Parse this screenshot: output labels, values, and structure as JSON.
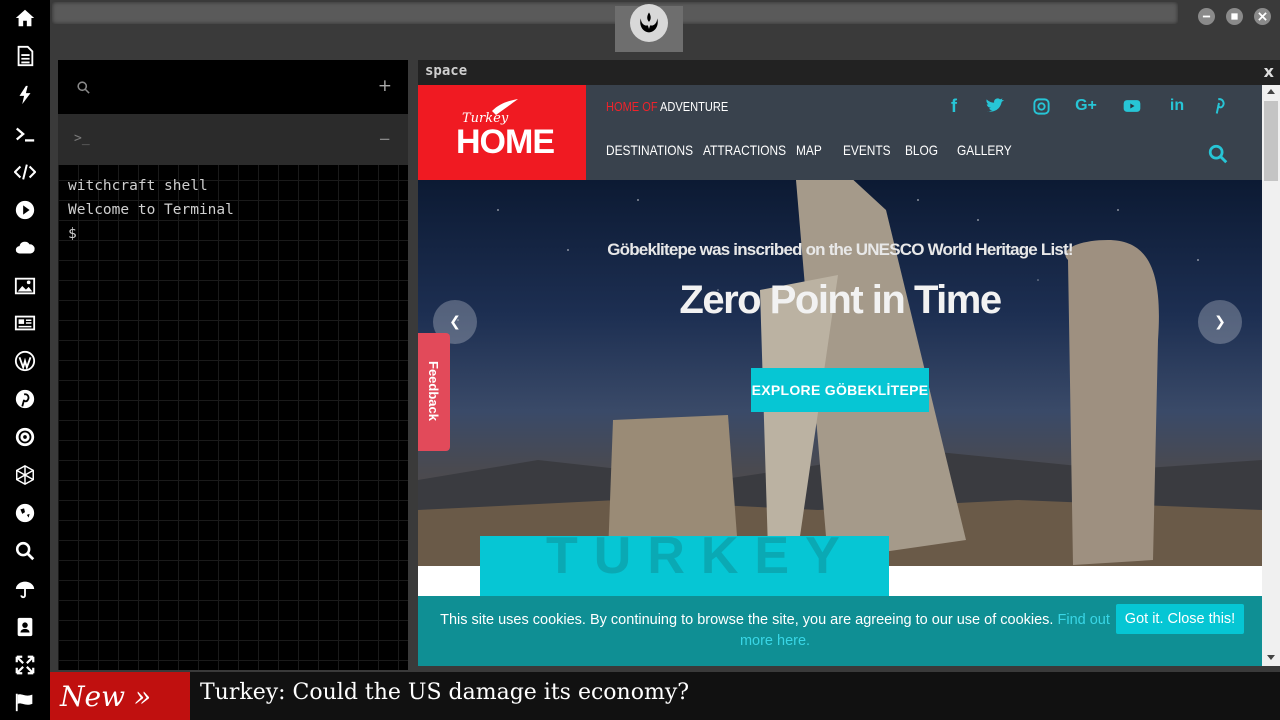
{
  "dock": {
    "items": [
      "home-icon",
      "document-icon",
      "bolt-icon",
      "terminal-icon",
      "code-icon",
      "play-icon",
      "cloud-icon",
      "image-icon",
      "news-icon",
      "wordpress-icon",
      "pinterest-icon",
      "empire-icon",
      "network-icon",
      "globe-icon",
      "search-icon",
      "umbrella-icon",
      "contacts-icon",
      "expand-icon",
      "flag-icon"
    ]
  },
  "topbar": {
    "logo_icon": "rebel-alliance-icon"
  },
  "terminal": {
    "search_icon": "search-icon",
    "add_label": "+",
    "tab_prompt": ">_",
    "tab_minus": "−",
    "lines": [
      "witchcraft shell",
      "Welcome to Terminal",
      "$"
    ]
  },
  "space": {
    "title": "space",
    "close_label": "x",
    "site": {
      "logo_script": "Turkey",
      "logo_main": "HOME",
      "tagline_prefix": "HOME OF",
      "tagline_suffix": "ADVENTURE",
      "nav": [
        "DESTINATIONS",
        "ATTRACTIONS",
        "MAP",
        "EVENTS",
        "BLOG",
        "GALLERY"
      ],
      "social": [
        "facebook-icon",
        "twitter-icon",
        "instagram-icon",
        "google-plus-icon",
        "youtube-icon",
        "linkedin-icon",
        "pinterest-icon"
      ],
      "hero": {
        "subtitle": "Göbeklitepe was inscribed on the UNESCO World Heritage List!",
        "title": "Zero Point in Time",
        "cta": "EXPLORE GÖBEKLİTEPE"
      },
      "feedback_label": "Feedback",
      "turkey_label": "TURKEY",
      "cookie": {
        "text": "This site uses cookies. By continuing to browse the site, you are agreeing to our use of cookies.",
        "link": "Find out more here.",
        "button": "Got it. Close this!"
      }
    }
  },
  "ticker": {
    "label": "New »",
    "headline": "Turkey: Could the US damage its economy?"
  },
  "colors": {
    "accent_cyan": "#06c6d4",
    "brand_red": "#f01a22",
    "ticker_red": "#c0100f",
    "cookie_bg": "#0f8f94"
  }
}
